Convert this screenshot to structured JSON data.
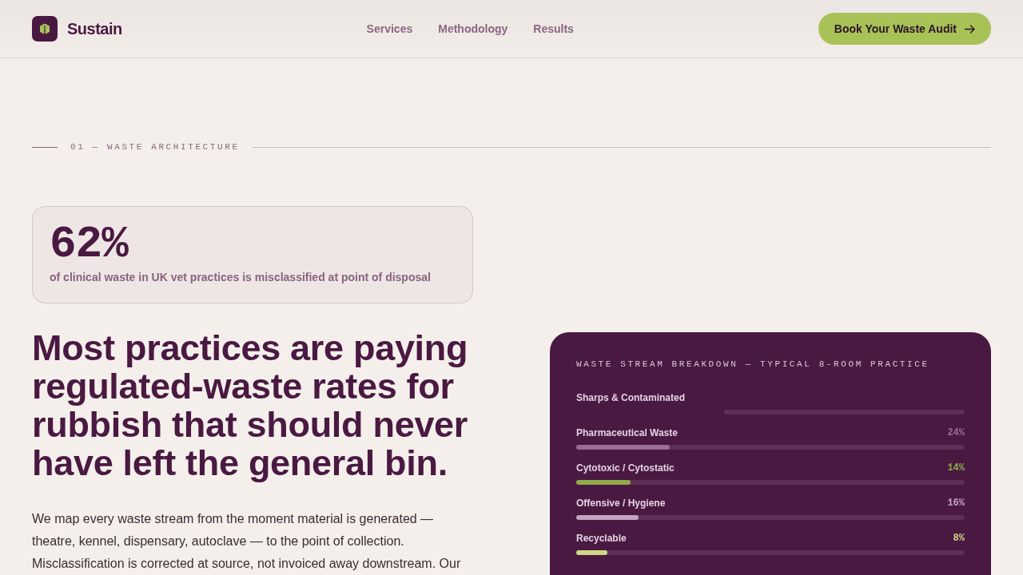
{
  "header": {
    "brand": "Sustain",
    "nav": [
      "Services",
      "Methodology",
      "Results"
    ],
    "cta": "Book Your Waste Audit"
  },
  "section": {
    "label": "01 — WASTE ARCHITECTURE"
  },
  "stat": {
    "value": "62%",
    "caption": "of clinical waste in UK vet practices is misclassified at point of disposal"
  },
  "headline": "Most practices are paying regulated-waste rates for rubbish that should never have left the general bin.",
  "body": "We map every waste stream from the moment material is generated — theatre, kennel, dispensary, autoclave — to the point of collection. Misclassification is corrected at source, not invoiced away downstream. Our",
  "breakdown": {
    "title": "WASTE STREAM BREAKDOWN — TYPICAL 8-ROOM PRACTICE",
    "streams": [
      {
        "kind": "offset",
        "name": "Sharps & Contaminated"
      },
      {
        "kind": "bar",
        "name": "Pharmaceutical Waste",
        "reading": "24%",
        "level": 0.24,
        "color": "#9a6d94"
      },
      {
        "kind": "bar",
        "name": "Cytotoxic / Cytostatic",
        "reading": "14%",
        "level": 0.14,
        "color": "#8fab4a"
      },
      {
        "kind": "bar",
        "name": "Offensive / Hygiene",
        "reading": "16%",
        "level": 0.16,
        "color": "#c4a2c0"
      },
      {
        "kind": "bar",
        "name": "Recyclable",
        "reading": "8%",
        "level": 0.08,
        "color": "#cfd784"
      }
    ]
  }
}
